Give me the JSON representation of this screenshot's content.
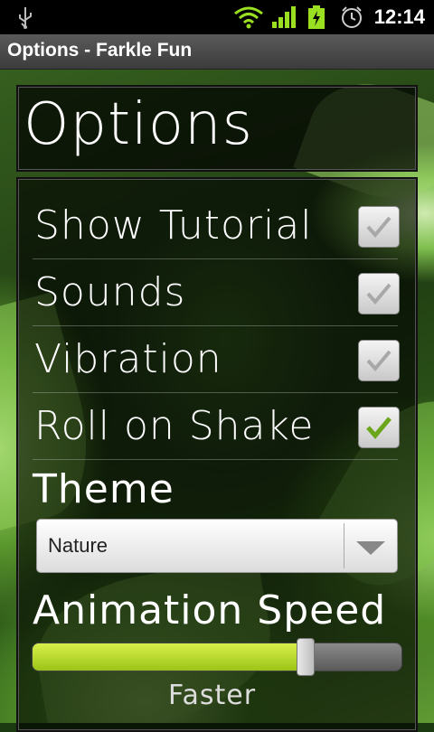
{
  "status_bar": {
    "time": "12:14",
    "icons": [
      "usb-icon",
      "wifi-icon",
      "signal-icon",
      "battery-charging-icon",
      "alarm-icon"
    ]
  },
  "titlebar": {
    "title": "Options - Farkle Fun"
  },
  "header": {
    "title": "Options"
  },
  "options": [
    {
      "label": "Show Tutorial",
      "checked": true
    },
    {
      "label": "Sounds",
      "checked": true
    },
    {
      "label": "Vibration",
      "checked": true
    },
    {
      "label": "Roll on Shake",
      "checked": true
    }
  ],
  "theme": {
    "label": "Theme",
    "selected": "Nature"
  },
  "animation": {
    "label": "Animation Speed",
    "value_label": "Faster",
    "level": 0.74
  },
  "colors": {
    "check_grey": "#a8a8a8",
    "check_green": "#6aa51a",
    "slider_fill": "#b8dc2a"
  }
}
